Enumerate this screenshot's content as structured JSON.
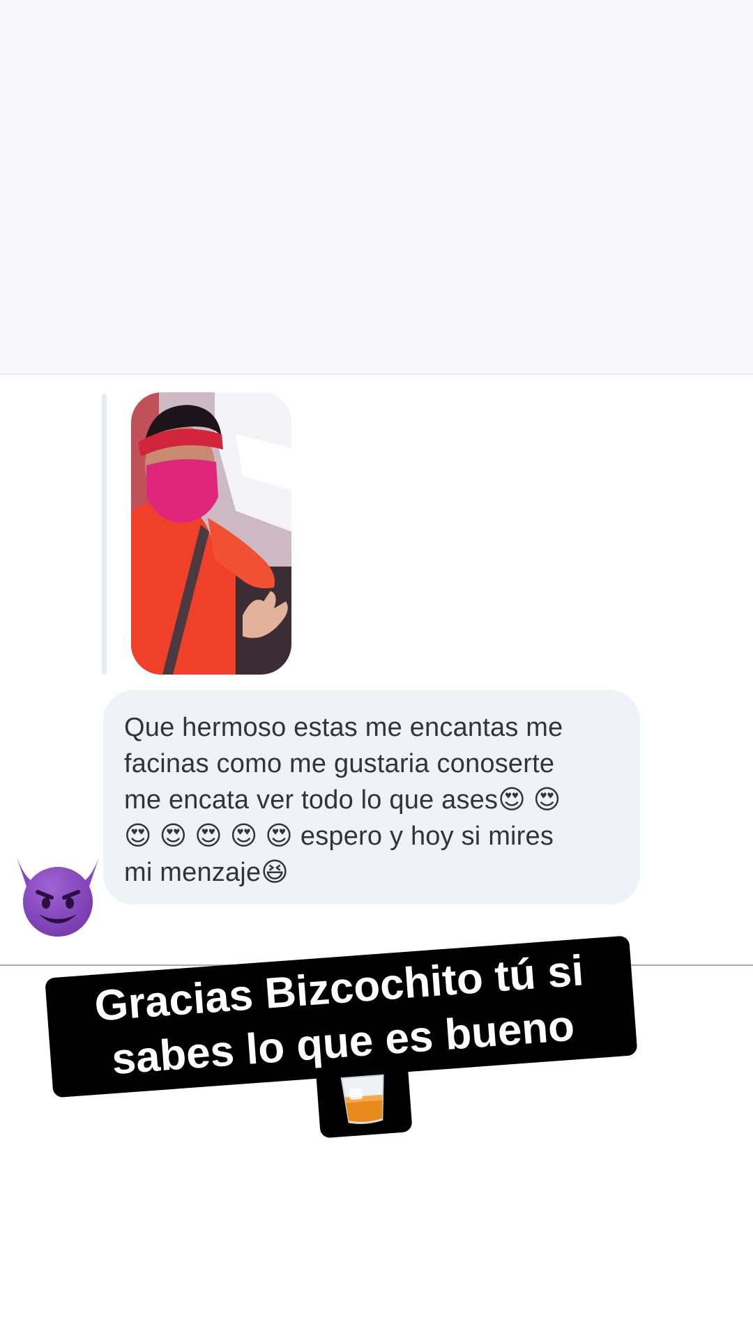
{
  "message": {
    "text": "Que hermoso estas me encantas me\nfacinas como me gustaria conoserte\nme encata ver todo lo que ases😍 😍\n😍 😍 😍 😍 😍 espero y hoy si mires\nmi menzaje😆"
  },
  "reply_photo": {
    "icon": "person-selfie-photo"
  },
  "sender_avatar": {
    "icon": "smiling-devil-emoji",
    "color": "#8a44c8"
  },
  "story_caption": {
    "line1": "Gracias Bizcochito tú si",
    "line2": "sabes lo que es bueno",
    "icon": "whiskey-glass-emoji"
  },
  "colors": {
    "bubble": "#f1f1fa",
    "caption_bg": "#000000",
    "caption_text": "#ffffff"
  }
}
